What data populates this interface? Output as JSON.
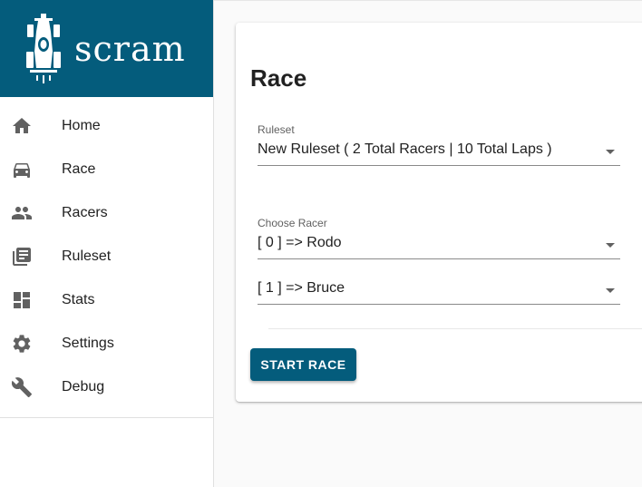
{
  "brand": {
    "title": "scram",
    "logo_icon": "race-car-icon",
    "color": "#045c7c"
  },
  "nav": {
    "items": [
      {
        "label": "Home",
        "icon": "home-icon"
      },
      {
        "label": "Race",
        "icon": "car-icon"
      },
      {
        "label": "Racers",
        "icon": "people-icon"
      },
      {
        "label": "Ruleset",
        "icon": "library-books-icon"
      },
      {
        "label": "Stats",
        "icon": "dashboard-icon"
      },
      {
        "label": "Settings",
        "icon": "gear-icon"
      },
      {
        "label": "Debug",
        "icon": "wrench-icon"
      }
    ]
  },
  "race": {
    "title": "Race",
    "ruleset": {
      "label": "Ruleset",
      "value": "New Ruleset ( 2 Total Racers | 10 Total Laps )"
    },
    "racers": {
      "label": "Choose Racer",
      "selections": [
        "[ 0 ] => Rodo",
        "[ 1 ] => Bruce"
      ]
    },
    "start_button": "START RACE"
  }
}
